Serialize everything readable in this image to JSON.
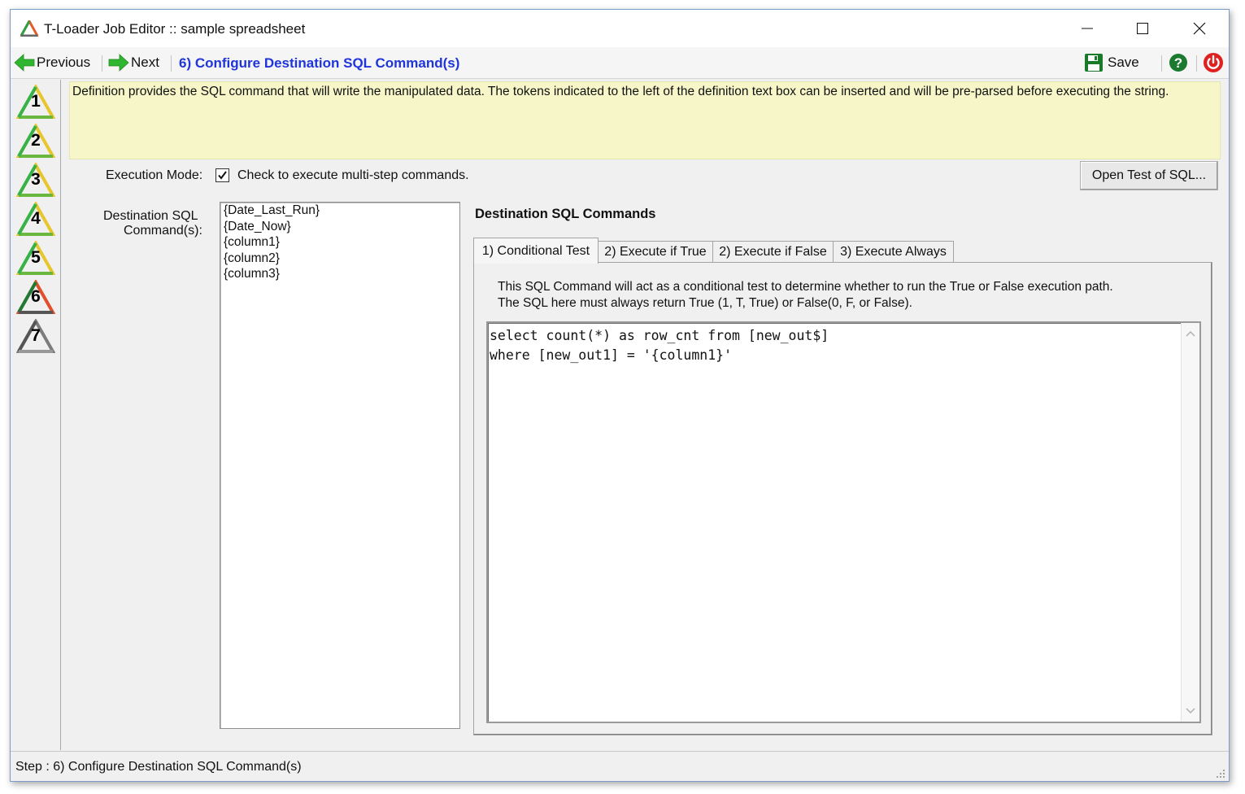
{
  "window": {
    "title": "T-Loader Job Editor :: sample spreadsheet"
  },
  "toolbar": {
    "previous_label": "Previous",
    "next_label": "Next",
    "step_title": "6) Configure Destination SQL Command(s)",
    "save_label": "Save"
  },
  "steps": [
    {
      "number": "1",
      "state": "complete"
    },
    {
      "number": "2",
      "state": "complete"
    },
    {
      "number": "3",
      "state": "complete"
    },
    {
      "number": "4",
      "state": "complete"
    },
    {
      "number": "5",
      "state": "complete"
    },
    {
      "number": "6",
      "state": "current"
    },
    {
      "number": "7",
      "state": "pending"
    }
  ],
  "help": {
    "text": "Definition provides the SQL command that will write the manipulated data. The tokens indicated to the left of the definition text box can be inserted and will be pre-parsed before executing the string."
  },
  "execution_mode": {
    "label": "Execution Mode:",
    "checkbox_label": "Check to execute multi-step commands.",
    "checked": true
  },
  "open_test_button": "Open Test of SQL...",
  "destination": {
    "label_line1": "Destination SQL",
    "label_line2": "Command(s):",
    "tokens": [
      "{Date_Last_Run}",
      "{Date_Now}",
      "{column1}",
      "{column2}",
      "{column3}"
    ]
  },
  "sql_commands": {
    "title": "Destination SQL Commands",
    "tabs": [
      {
        "label": "1) Conditional Test",
        "active": true
      },
      {
        "label": "2) Execute if True",
        "active": false
      },
      {
        "label": "2) Execute if False",
        "active": false
      },
      {
        "label": "3) Execute Always",
        "active": false
      }
    ],
    "description_line1": "This SQL Command will act as a conditional test to determine whether to run the True or False execution path.",
    "description_line2": "The SQL here must always return True (1, T, True) or False(0, F, or False).",
    "sql_line1": "select count(*) as row_cnt from [new_out$]",
    "sql_line2": "where [new_out1] = '{column1}'"
  },
  "status": {
    "text": "Step : 6) Configure Destination SQL Command(s)"
  },
  "colors": {
    "step_title": "#1f34d9",
    "help_background": "#f6f6c8",
    "nav_arrow": "#2fb52f",
    "save_icon": "#1a7a2c",
    "help_icon": "#1c7a30",
    "power_icon": "#e02020"
  },
  "icons": {
    "app": "t-loader-triangle-icon",
    "previous": "green-arrow-left-icon",
    "next": "green-arrow-right-icon",
    "save": "floppy-disk-icon",
    "help": "question-mark-icon",
    "exit": "power-icon"
  }
}
